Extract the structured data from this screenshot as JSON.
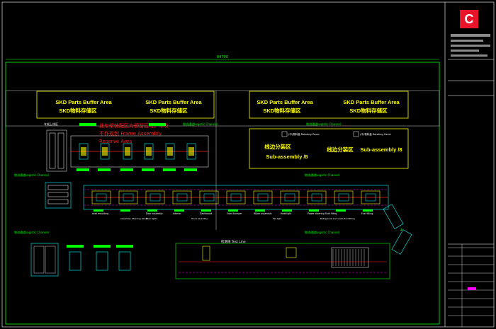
{
  "dimension": {
    "overall": "84700"
  },
  "buffer_areas": [
    {
      "en": "SKD Parts Buffer Area",
      "cn": "SKD物料存储区"
    },
    {
      "en": "SKD Parts Buffer Area",
      "cn": "SKD物料存储区"
    },
    {
      "en": "SKD Parts Buffer Area",
      "cn": "SKD物料存储区"
    },
    {
      "en": "SKD Parts Buffer Area",
      "cn": "SKD物料存储区"
    }
  ],
  "sub_assembly": [
    {
      "cn": "线边分装区",
      "en": "Sub-assembly /8"
    },
    {
      "cn": "线边分装区",
      "en": "Sub-assembly /8"
    }
  ],
  "rotating_cover": [
    "(中)物料盖 Rotating Cover",
    "(中)物料盖 Rotating Cover"
  ],
  "logistic_channel": [
    "物流通道Logistic Channel",
    "物流通道Logistic Channel",
    "物流通道Logistic Channel",
    "物流通道Logistic Channel",
    "物流通道Logistic Channel",
    "物流通道Logistic Channel"
  ],
  "test_line": "检测线 Test Line",
  "red_note": [
    "此车架装配区为预留区域，本次",
    "不作规划 Frame Assembly",
    "Reserve Area"
  ],
  "cabinet_label": "车架上线区",
  "station_labels": [
    "seat mounting",
    "Door assembly",
    "Interior",
    "Dashboard",
    "Front bumper",
    "Wiper assembly",
    "Headlight",
    "Power steering fluid filling",
    "Fuel filling"
  ],
  "sub_labels": [
    "assembly: Steering wheel",
    "Rear lights",
    "Hood assembly",
    "Tail light",
    "Refrigerant and wash fluid filling"
  ],
  "logo_letter": "C",
  "colors": {
    "background": "#000000",
    "frame": "#00ff00",
    "accent": "#ff2020",
    "buffer": "#ffff00"
  }
}
